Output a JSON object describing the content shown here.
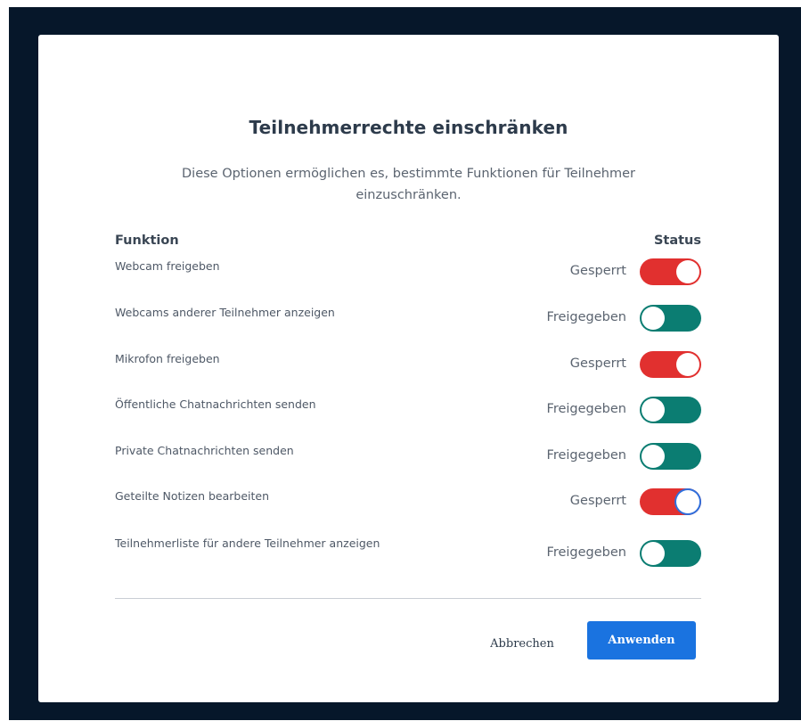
{
  "dialog": {
    "title": "Teilnehmerrechte einschränken",
    "description": "Diese Optionen ermöglichen es, bestimmte Funktionen für Teilnehmer einzuschränken."
  },
  "table": {
    "col_function": "Funktion",
    "col_status": "Status",
    "rows": [
      {
        "label": "Webcam freigeben",
        "status": "Gesperrt",
        "state": "locked"
      },
      {
        "label": "Webcams anderer Teilnehmer anzeigen",
        "status": "Freigegeben",
        "state": "free"
      },
      {
        "label": "Mikrofon freigeben",
        "status": "Gesperrt",
        "state": "locked"
      },
      {
        "label": "Öffentliche Chatnachrichten senden",
        "status": "Freigegeben",
        "state": "free"
      },
      {
        "label": "Private Chatnachrichten senden",
        "status": "Freigegeben",
        "state": "free"
      },
      {
        "label": "Geteilte Notizen bearbeiten",
        "status": "Gesperrt",
        "state": "locked"
      },
      {
        "label": "Teilnehmerliste für andere Teilnehmer anzeigen",
        "status": "Freigegeben",
        "state": "free"
      }
    ]
  },
  "footer": {
    "cancel_label": "Abbrechen",
    "apply_label": "Anwenden"
  },
  "colors": {
    "locked": "#e1302f",
    "free": "#0b7d72",
    "primary": "#1a73e0",
    "backdrop": "#06172a"
  }
}
